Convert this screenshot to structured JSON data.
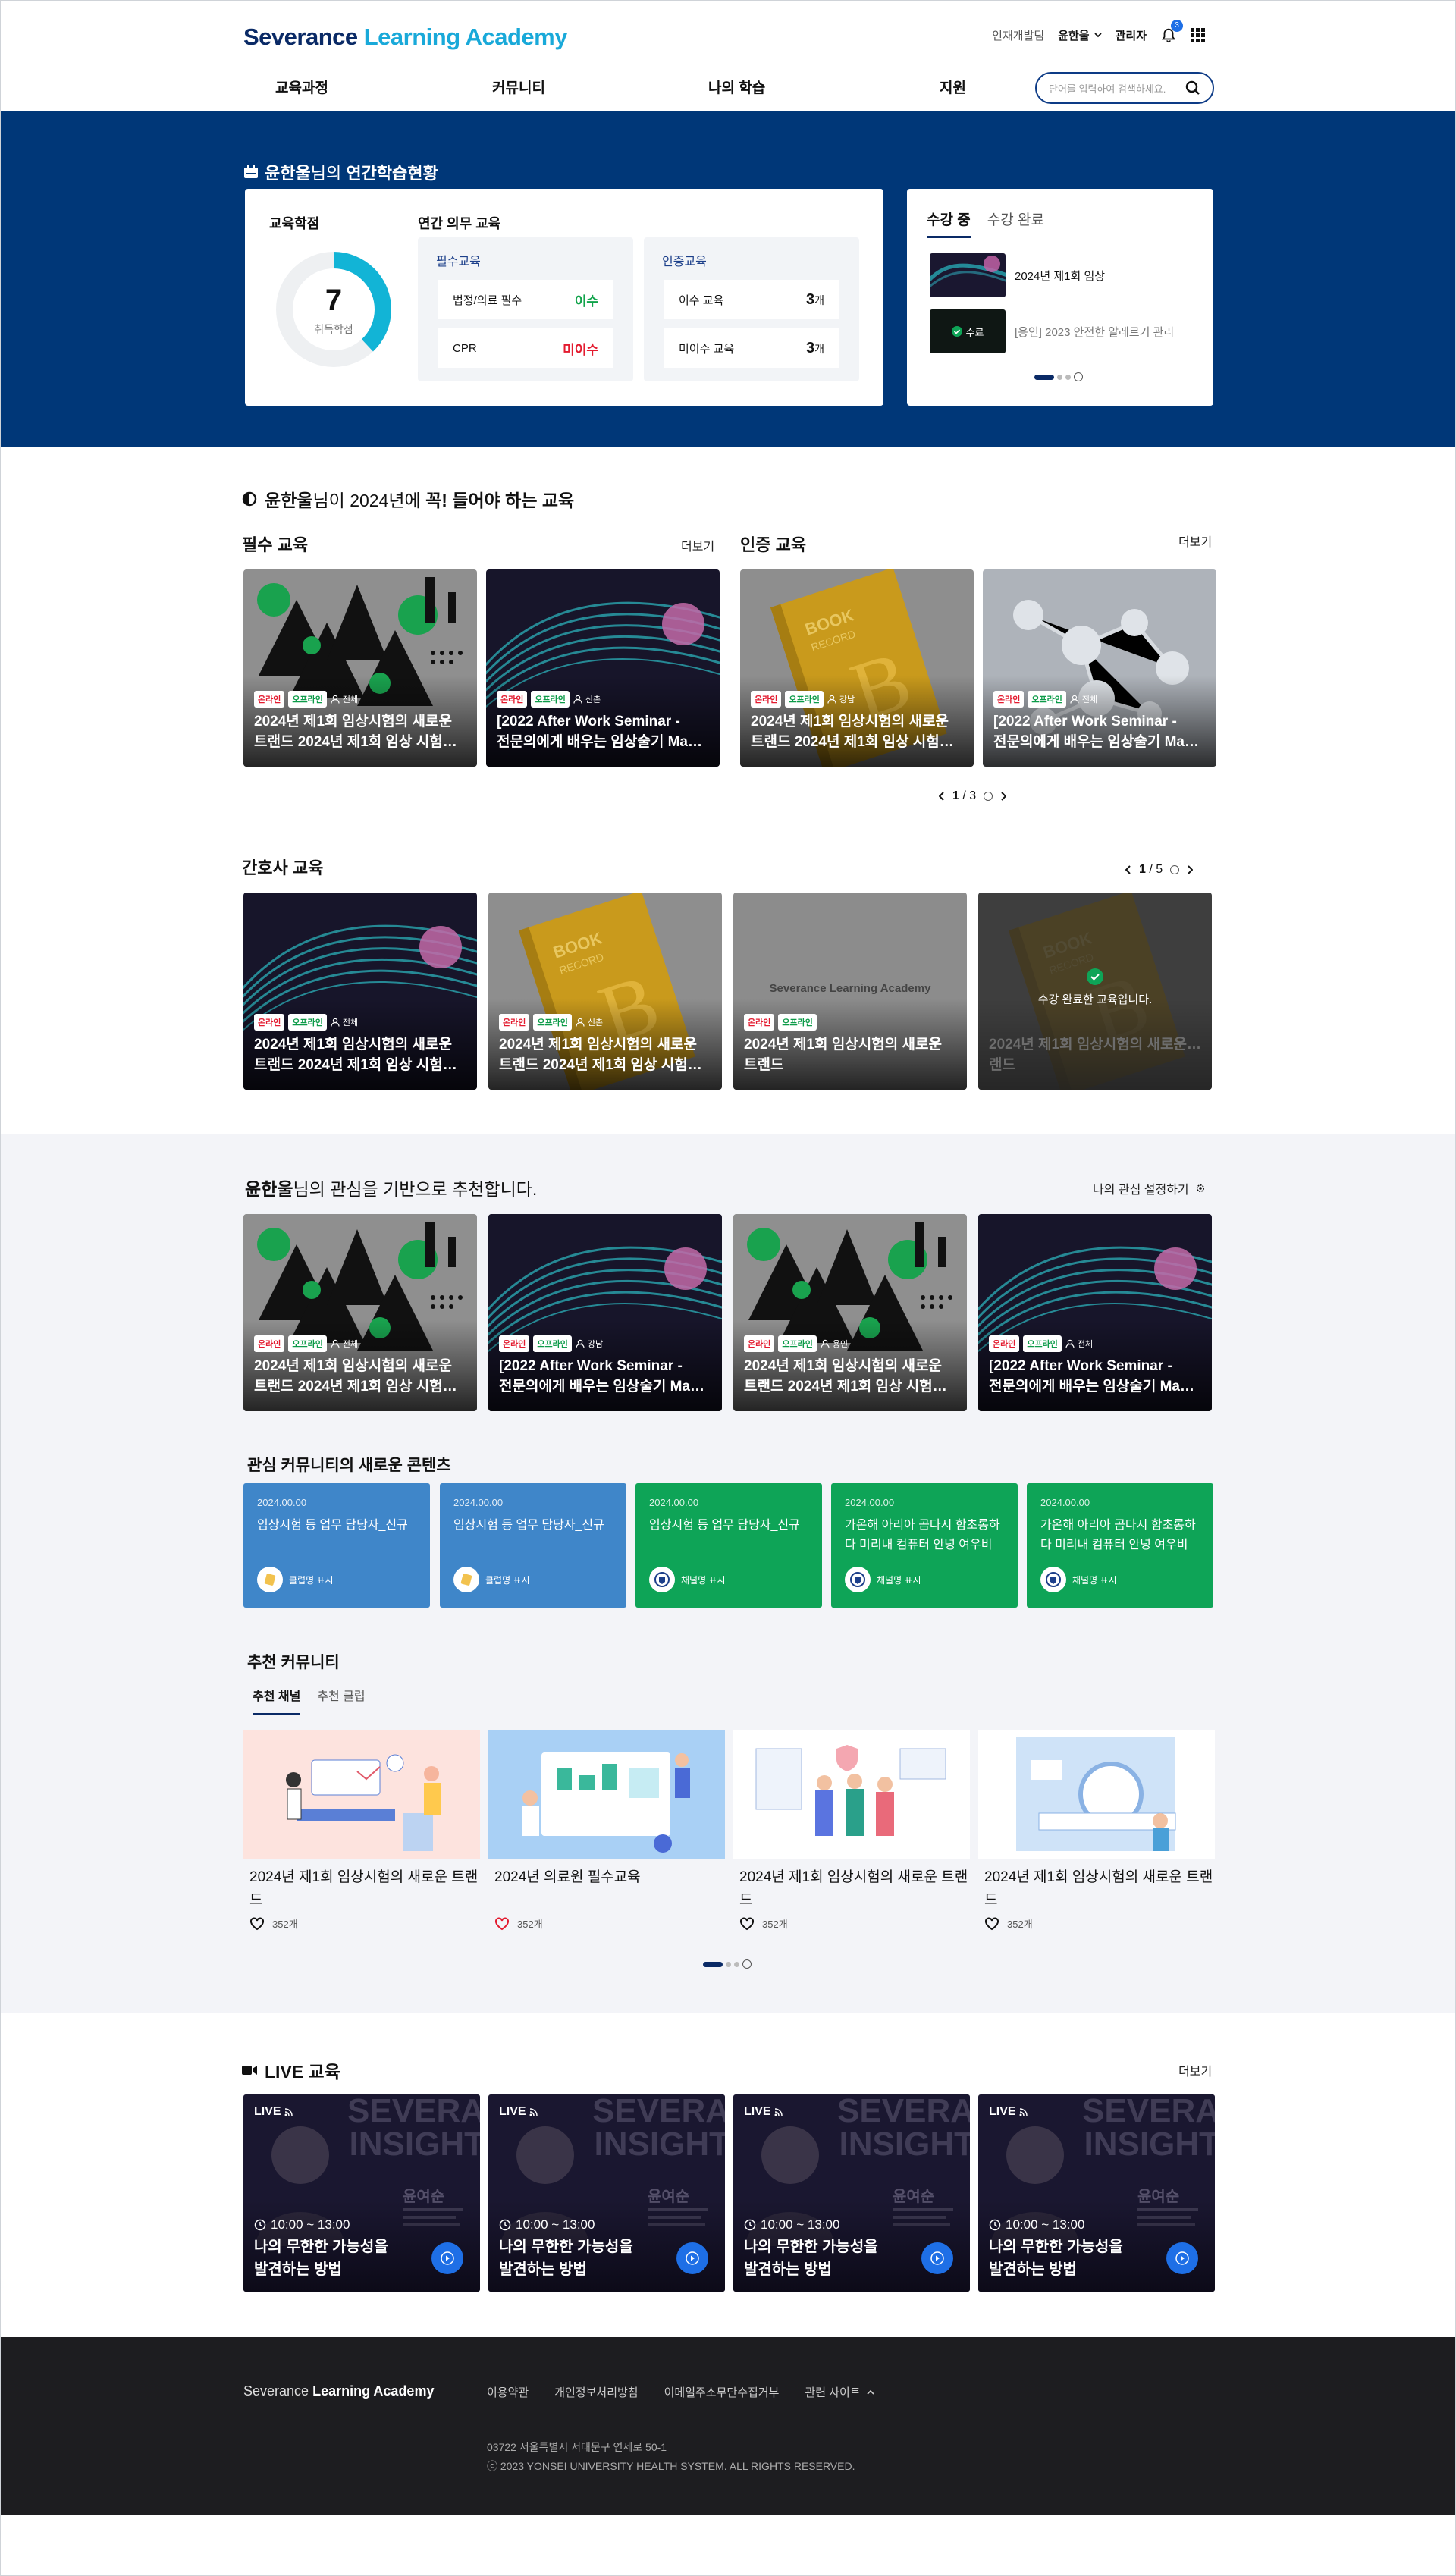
{
  "header": {
    "logo_main": "Severance",
    "logo_accent": "Learning Academy",
    "dept": "인재개발팀",
    "user": "윤한울",
    "admin": "관리자",
    "notif_count": "3",
    "nav": [
      "교육과정",
      "커뮤니티",
      "나의 학습",
      "지원"
    ],
    "search_placeholder": "단어를 입력하여 검색하세요."
  },
  "status": {
    "title_name": "윤한울",
    "title_rest": "님의 ",
    "title_bold": "연간학습현황",
    "credit_title": "교육학점",
    "credit_value": "7",
    "credit_label": "취득학점",
    "credit_ratio": 0.38,
    "annual_title": "연간 의무 교육",
    "required": {
      "title": "필수교육",
      "rows": [
        {
          "label": "법정/의료 필수",
          "value": "이수"
        },
        {
          "label": "CPR",
          "value": "미이수"
        }
      ]
    },
    "cert": {
      "title": "인증교육",
      "rows": [
        {
          "label": "이수 교육",
          "num": "3",
          "unit": "개"
        },
        {
          "label": "미이수 교육",
          "num": "3",
          "unit": "개"
        }
      ]
    },
    "tabs": [
      "수강 중",
      "수강 완료"
    ],
    "in_progress": [
      {
        "title": "2024년 제1회 임상"
      },
      {
        "title": "[용인] 2023 안전한 알레르기 관리",
        "badge": "수료"
      }
    ]
  },
  "must": {
    "title_name": "윤한울",
    "title_mid": "님이 2024년에 ",
    "title_bold": "꼭! 들어야 하는 교육",
    "required_title": "필수 교육",
    "cert_title": "인증 교육",
    "more": "더보기",
    "tags": {
      "online": "온라인",
      "offline": "오프라인"
    },
    "cards": [
      {
        "who": "전체",
        "line1": "2024년 제1회 임상시험의 새로운",
        "line2": "트랜드 2024년 제1회 임상 시험의 새로운 트랜드"
      },
      {
        "who": "신촌",
        "line1": "[2022 After Work Seminar -",
        "line2": "전문의에게 배우는 임상술기 Master Class]"
      },
      {
        "who": "강남",
        "line1": "2024년 제1회 임상시험의 새로운",
        "line2": "트랜드 2024년 제1회 임상 시험의 새로운 트랜드"
      },
      {
        "who": "전체",
        "line1": "[2022 After Work Seminar -",
        "line2": "전문의에게 배우는 임상술기 Master Class]"
      }
    ],
    "pager_cur": "1",
    "pager_total": "3"
  },
  "nurse": {
    "title": "간호사 교육",
    "pager_cur": "1",
    "pager_total": "5",
    "cards": [
      {
        "who": "전체",
        "line1": "2024년 제1회 임상시험의 새로운",
        "line2": "트랜드 2024년 제1회 임상 시험의 새로운 트랜드"
      },
      {
        "who": "신촌",
        "line1": "2024년 제1회 임상시험의 새로운",
        "line2": "트랜드 2024년 제1회 임상 시험의 새로운 트랜드"
      },
      {
        "who": "",
        "line1": "2024년 제1회 임상시험의 새로운",
        "line2": "트랜드"
      },
      {
        "who": "",
        "line1": "2024년 제1회 임상시험의 새로운 트",
        "line2": "랜드"
      }
    ],
    "placeholder_logo": "Severance Learning Academy",
    "completed_msg": "수강 완료한 교육입니다."
  },
  "recommend": {
    "title_name": "윤한울",
    "title_rest": "님의 관심을 기반으로 추천합니다.",
    "settings": "나의 관심 설정하기",
    "cards": [
      {
        "who": "전체",
        "line1": "2024년 제1회 임상시험의 새로운",
        "line2": "트랜드 2024년 제1회 임상 시험의 새로운 트랜드"
      },
      {
        "who": "강남",
        "line1": "[2022 After Work Seminar -",
        "line2": "전문의에게 배우는 임상술기 Master Class]"
      },
      {
        "who": "용인",
        "line1": "2024년 제1회 임상시험의 새로운",
        "line2": "트랜드 2024년 제1회 임상 시험의 새로운 트랜드"
      },
      {
        "who": "전체",
        "line1": "[2022 After Work Seminar -",
        "line2": "전문의에게 배우는 임상술기 Master Class]"
      }
    ]
  },
  "community_new": {
    "title": "관심 커뮤니티의 새로운 콘텐츠",
    "cards": [
      {
        "date": "2024.00.00",
        "text": "임상시험 등 업무 담당자_신규",
        "ch": "클럽명 표시",
        "color": "#3f86c9"
      },
      {
        "date": "2024.00.00",
        "text": "임상시험 등 업무 담당자_신규",
        "ch": "클럽명 표시",
        "color": "#3f86c9"
      },
      {
        "date": "2024.00.00",
        "text": "임상시험 등 업무 담당자_신규",
        "ch": "채널명 표시",
        "color": "#0ea457"
      },
      {
        "date": "2024.00.00",
        "text": "가온해 아리아 곰다시 함초롱하다 미리내 컴퓨터 안녕  여우비",
        "ch": "채널명 표시",
        "color": "#0ea457"
      },
      {
        "date": "2024.00.00",
        "text": "가온해 아리아 곰다시 함초롱하다 미리내 컴퓨터 안녕  여우비",
        "ch": "채널명 표시",
        "color": "#0ea457"
      }
    ]
  },
  "rec_community": {
    "title": "추천 커뮤니티",
    "tabs": [
      "추천 채널",
      "추천 클럽"
    ],
    "items": [
      {
        "title": "2024년 제1회 임상시험의 새로운 트랜드",
        "likes": "352개"
      },
      {
        "title": "2024년 의료원 필수교육",
        "likes": "352개"
      },
      {
        "title": "2024년 제1회 임상시험의 새로운 트랜드",
        "likes": "352개"
      },
      {
        "title": "2024년 제1회 임상시험의 새로운 트랜드",
        "likes": "352개"
      }
    ]
  },
  "live": {
    "title": "LIVE 교육",
    "more": "더보기",
    "badge": "LIVE",
    "bg_line1": "SEVERA",
    "bg_line2": "INSIGHT",
    "speaker": "윤여순",
    "cards": [
      {
        "time": "10:00 ~ 13:00",
        "line1": "나의 무한한 가능성을",
        "line2": "발견하는 방법"
      },
      {
        "time": "10:00 ~ 13:00",
        "line1": "나의 무한한 가능성을",
        "line2": "발견하는 방법"
      },
      {
        "time": "10:00 ~ 13:00",
        "line1": "나의 무한한 가능성을",
        "line2": "발견하는 방법"
      },
      {
        "time": "10:00 ~ 13:00",
        "line1": "나의 무한한 가능성을",
        "line2": "발견하는 방법"
      }
    ]
  },
  "footer": {
    "logo_a": "Severance",
    "logo_b": "Learning Academy",
    "links": [
      "이용약관",
      "개인정보처리방침",
      "이메일주소무단수집거부",
      "관련 사이트"
    ],
    "address": "03722 서울특별시 서대문구 연세로 50-1",
    "copyright": "ⓒ 2023 YONSEI UNIVERSITY HEALTH SYSTEM. ALL RIGHTS RESERVED."
  },
  "colors": {
    "navy": "#003778",
    "accent": "#19a9d9",
    "green": "#0ea457",
    "blue": "#3f86c9"
  }
}
